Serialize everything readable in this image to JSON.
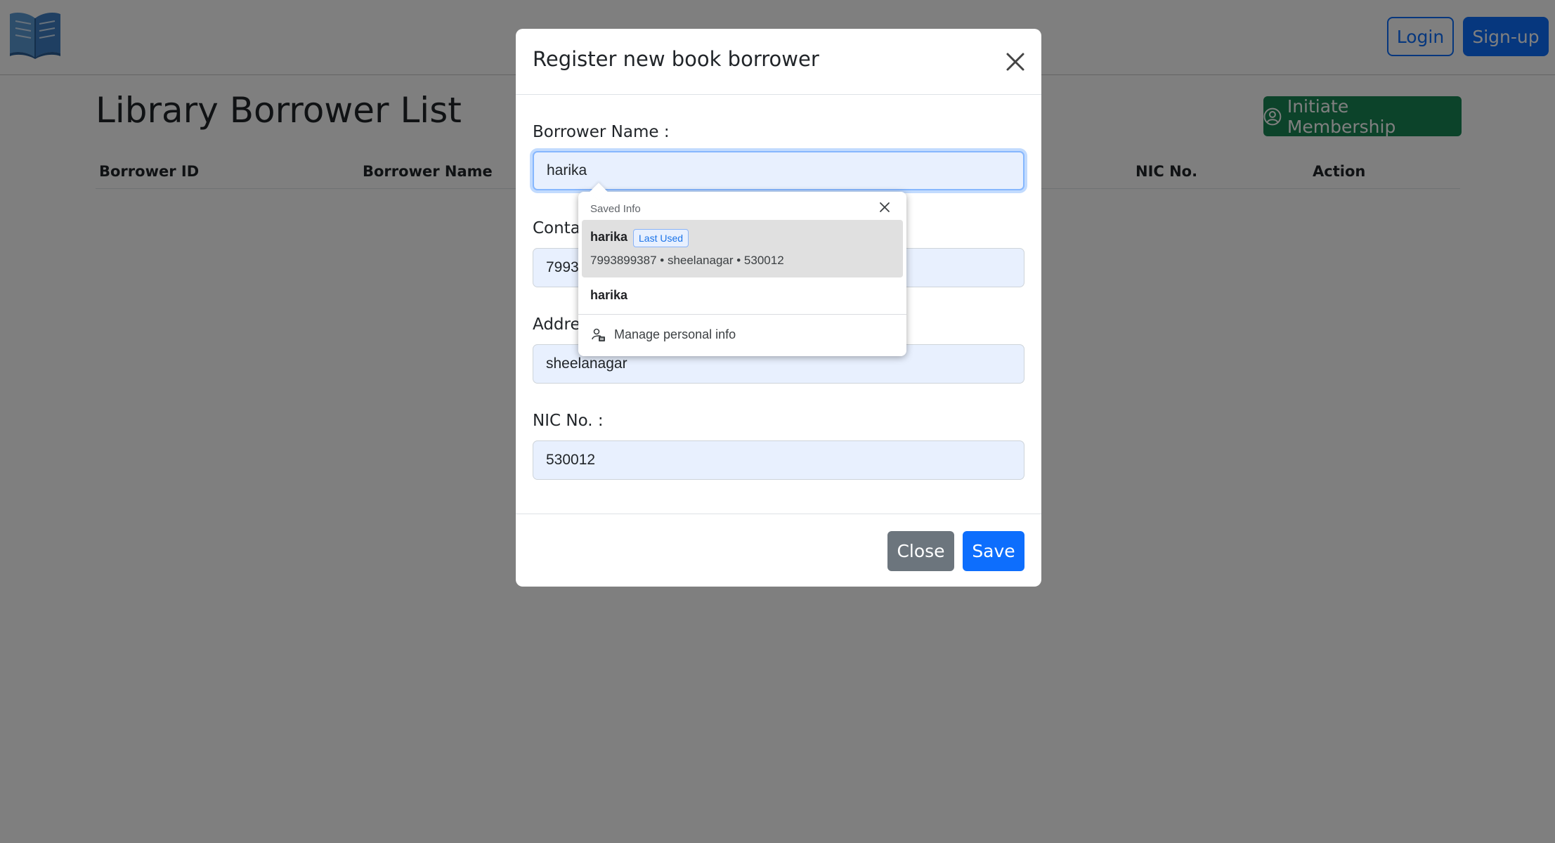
{
  "navbar": {
    "logo_icon": "open-book-icon",
    "login_label": "Login",
    "signup_label": "Sign-up"
  },
  "page": {
    "title": "Library Borrower List",
    "membership_label": "Initiate Membership",
    "membership_icon": "user-circle-icon",
    "columns": [
      "Borrower ID",
      "Borrower Name",
      "NIC No.",
      "Action"
    ]
  },
  "modal": {
    "title": "Register new book borrower",
    "close_icon": "close-icon",
    "fields": {
      "name": {
        "label": "Borrower Name :",
        "value": "harika"
      },
      "contact": {
        "label": "Conta",
        "value": "7993"
      },
      "address": {
        "label": "Addre",
        "value": "sheelanagar"
      },
      "nic": {
        "label": "NIC No. :",
        "value": "530012"
      }
    },
    "close_label": "Close",
    "save_label": "Save"
  },
  "autofill": {
    "header": "Saved Info",
    "items": [
      {
        "name": "harika",
        "badge": "Last Used",
        "detail": "7993899387 • sheelanagar • 530012"
      },
      {
        "name": "harika"
      }
    ],
    "manage_label": "Manage personal info"
  },
  "colors": {
    "primary": "#0d6efd",
    "success": "#198754",
    "secondary": "#6c757d",
    "autofill_bg": "#e8f0fe"
  }
}
